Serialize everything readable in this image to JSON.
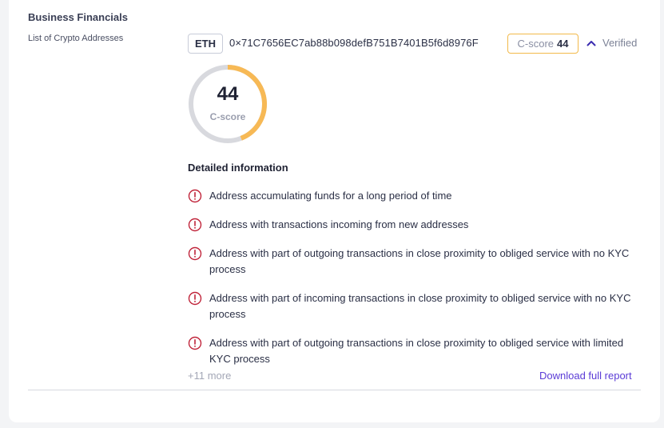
{
  "section": {
    "title": "Business Financials",
    "field_label": "List of Crypto Addresses"
  },
  "address_row": {
    "chain": "ETH",
    "address": "0×71C7656EC7ab88b098defB751B7401B5f6d8976F",
    "score_label": "C-score",
    "score_value": "44",
    "verified_label": "Verified"
  },
  "gauge": {
    "value": "44",
    "label": "C-score",
    "fill_fraction": 0.44,
    "fill_color": "#f7b955",
    "track_color": "#d8d9de"
  },
  "details": {
    "title": "Detailed information",
    "items": [
      "Address accumulating funds for a long period of time",
      "Address with transactions incoming from new addresses",
      "Address with part of outgoing transactions in close proximity to obliged service with no KYC process",
      "Address with part of incoming transactions in close proximity to obliged service with no KYC process",
      "Address with part of outgoing transactions in close proximity to obliged service with limited KYC process"
    ],
    "icon": "alert-circle-icon",
    "icon_color": "#c0243a",
    "more_label": "+11 more",
    "download_label": "Download full report"
  }
}
